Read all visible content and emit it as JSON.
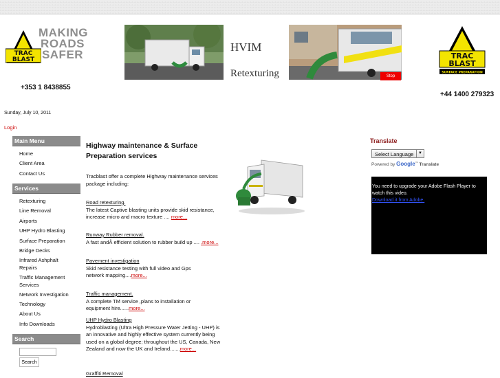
{
  "header": {
    "logo_left": {
      "line1": "TRAC",
      "line2": "BLAST"
    },
    "slogan": [
      "MAKING",
      "ROADS",
      "SAFER"
    ],
    "phone_left": "+353 1 8438855",
    "banner_title_1": "HVIM",
    "banner_title_2": "Retexturing",
    "stop_label": "Stop",
    "logo_right": {
      "line1": "TRAC",
      "line2": "BLAST",
      "tagline": "SURFACE PREPARATION"
    },
    "phone_right": "+44 1400 279323"
  },
  "date": "Sunday, July 10, 2011",
  "login_label": "Login",
  "sidebar": {
    "main_menu_heading": "Main Menu",
    "main_menu_items": [
      "Home",
      "Client Area",
      "Contact Us"
    ],
    "services_heading": "Services",
    "services_items": [
      "Retexturing",
      "Line Removal",
      "Airports",
      "UHP Hydro Blasting",
      "Surface Preparation",
      "Bridge Decks",
      "Infrared Ashphalt Repairs",
      "Traffic Management Services",
      "Network Investigation",
      "Technology",
      "About Us",
      "Info Downloads"
    ],
    "search_heading": "Search",
    "search_value": "",
    "search_button": "Search"
  },
  "main": {
    "title": "Highway maintenance & Surface Preparation services",
    "intro": "Tracblast offer a complete Highway maintenance services package including:",
    "services": [
      {
        "title": "Road retexturing.",
        "text": "The latest Captive blasting units provide skid resistance, increase micro and macro texture ....",
        "more": "more..."
      },
      {
        "title": "Runway Rubber removal.",
        "text": "A fast andÂ  efficient solution to rubber build up ....",
        "more": ".more..."
      },
      {
        "title": "Pavement investigation",
        "text": "Skid resistance testing with full video and Gps network mapping....",
        "more": "more..."
      },
      {
        "title": "Traffic management.",
        "text": "A complete TM service ,plans to installation or equipment hire......",
        "more": "more..."
      },
      {
        "title": "UHP Hydro Blasting",
        "text": "Hydroblasting (Ultra High Pressure Water Jetting - UHP) is an innovative and highly effective system currently being used on a global degree; throughout the US, Canada, New Zealand and now the UK and Ireland.......",
        "more": "more..."
      },
      {
        "title": "Graffiti Removal",
        "text": "",
        "more": ""
      }
    ]
  },
  "right": {
    "translate_heading": "Translate",
    "select_language": "Select Language",
    "powered_by": "Powered by",
    "google": "Google",
    "translate_word": "Translate",
    "flash_text": "You need to upgrade your Adobe Flash Player to watch this video.",
    "flash_link": "Download it from Adobe."
  },
  "colors": {
    "sidebar_heading": "#8b8b8b",
    "link_more": "#cc0000",
    "translate_heading": "#8b1a1a",
    "stop_button": "#ee0000"
  }
}
